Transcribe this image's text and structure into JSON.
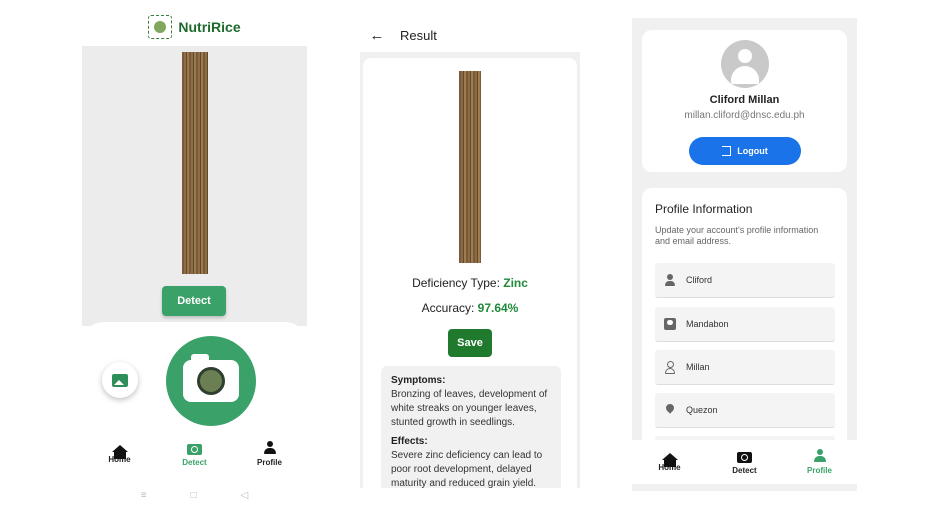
{
  "detect_screen": {
    "brand": "NutriRice",
    "detect_label": "Detect",
    "nav": [
      {
        "label": "Home",
        "icon": "home-icon"
      },
      {
        "label": "Detect",
        "icon": "camera-icon"
      },
      {
        "label": "Profile",
        "icon": "person-icon"
      }
    ],
    "active_tab": "Detect"
  },
  "result_screen": {
    "title": "Result",
    "deficiency_label": "Deficiency Type: ",
    "deficiency_value": "Zinc",
    "accuracy_label": "Accuracy: ",
    "accuracy_value": "97.64%",
    "save_label": "Save",
    "symptoms_heading": "Symptoms:",
    "symptoms_text": "Bronzing of leaves, development of white streaks on younger leaves, stunted growth in seedlings.",
    "effects_heading": "Effects:",
    "effects_text": "Severe zinc deficiency can lead to poor root development, delayed maturity and reduced grain yield."
  },
  "profile_screen": {
    "user_name": "Cliford Millan",
    "user_email": "millan.cliford@dnsc.edu.ph",
    "logout_label": "Logout",
    "section_title": "Profile Information",
    "section_desc": "Update your account's profile information and email address.",
    "fields": [
      {
        "value": "Cliford",
        "icon": "person-icon"
      },
      {
        "value": "Mandabon",
        "icon": "badge-icon"
      },
      {
        "value": "Millan",
        "icon": "person-outline-icon"
      },
      {
        "value": "Quezon",
        "icon": "location-pin-icon"
      }
    ],
    "nav": [
      {
        "label": "Home"
      },
      {
        "label": "Detect"
      },
      {
        "label": "Profile"
      }
    ],
    "active_tab": "Profile"
  },
  "system_nav": {
    "menu": "≡",
    "home": "□",
    "back": "◁"
  },
  "colors": {
    "primary_green": "#3aa169",
    "dark_green": "#1f7a2e",
    "accent_text_green": "#1f8a3a",
    "logout_blue": "#1a73e8"
  }
}
